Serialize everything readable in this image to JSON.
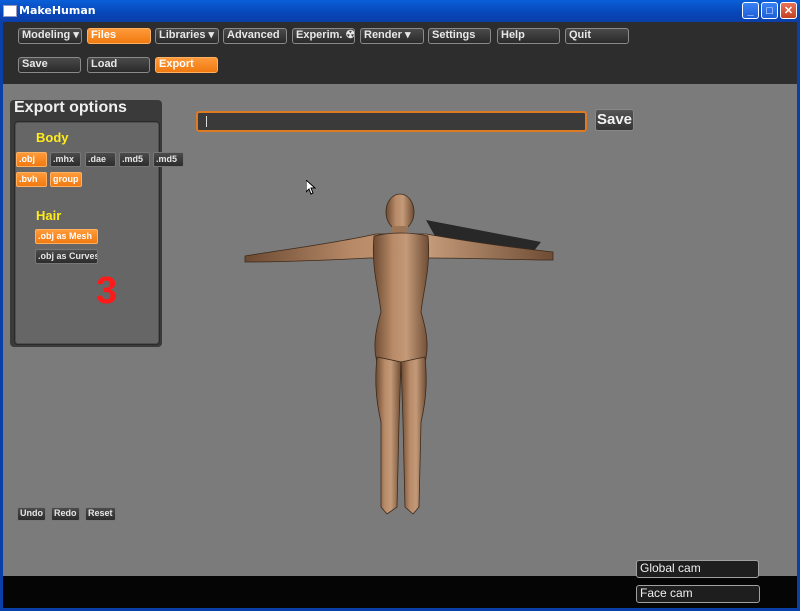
{
  "window": {
    "title": "MakeHuman"
  },
  "menu": {
    "tabs": [
      {
        "label": "Modeling ▾",
        "active": false
      },
      {
        "label": "Files",
        "active": true
      },
      {
        "label": "Libraries ▾",
        "active": false
      },
      {
        "label": "Advanced",
        "active": false
      },
      {
        "label": "Experim. ☢",
        "active": false
      },
      {
        "label": "Render ▾",
        "active": false
      },
      {
        "label": "Settings",
        "active": false
      },
      {
        "label": "Help",
        "active": false
      },
      {
        "label": "Quit",
        "active": false
      }
    ],
    "subtabs": [
      {
        "label": "Save",
        "active": false
      },
      {
        "label": "Load",
        "active": false
      },
      {
        "label": "Export",
        "active": true
      }
    ]
  },
  "export_panel": {
    "title": "Export options",
    "body_label": "Body",
    "body_options": [
      {
        "label": ".obj",
        "active": true
      },
      {
        "label": ".mhx",
        "active": false
      },
      {
        "label": ".dae",
        "active": false
      },
      {
        "label": ".md5",
        "active": false
      },
      {
        "label": ".md5",
        "active": false
      },
      {
        "label": ".bvh",
        "active": true
      },
      {
        "label": "group",
        "active": true
      }
    ],
    "hair_label": "Hair",
    "hair_options": [
      {
        "label": ".obj as Mesh",
        "active": true
      },
      {
        "label": ".obj as Curves",
        "active": false
      }
    ],
    "annotation": "3"
  },
  "filename": {
    "value": "",
    "save_label": "Save"
  },
  "history": {
    "undo": "Undo",
    "redo": "Redo",
    "reset": "Reset"
  },
  "cameras": {
    "global": "Global cam",
    "face": "Face cam"
  },
  "colors": {
    "accent": "#f07a10",
    "section": "#ffec1a",
    "annotation": "#ff1a1a",
    "viewport": "#7b7b7b"
  }
}
